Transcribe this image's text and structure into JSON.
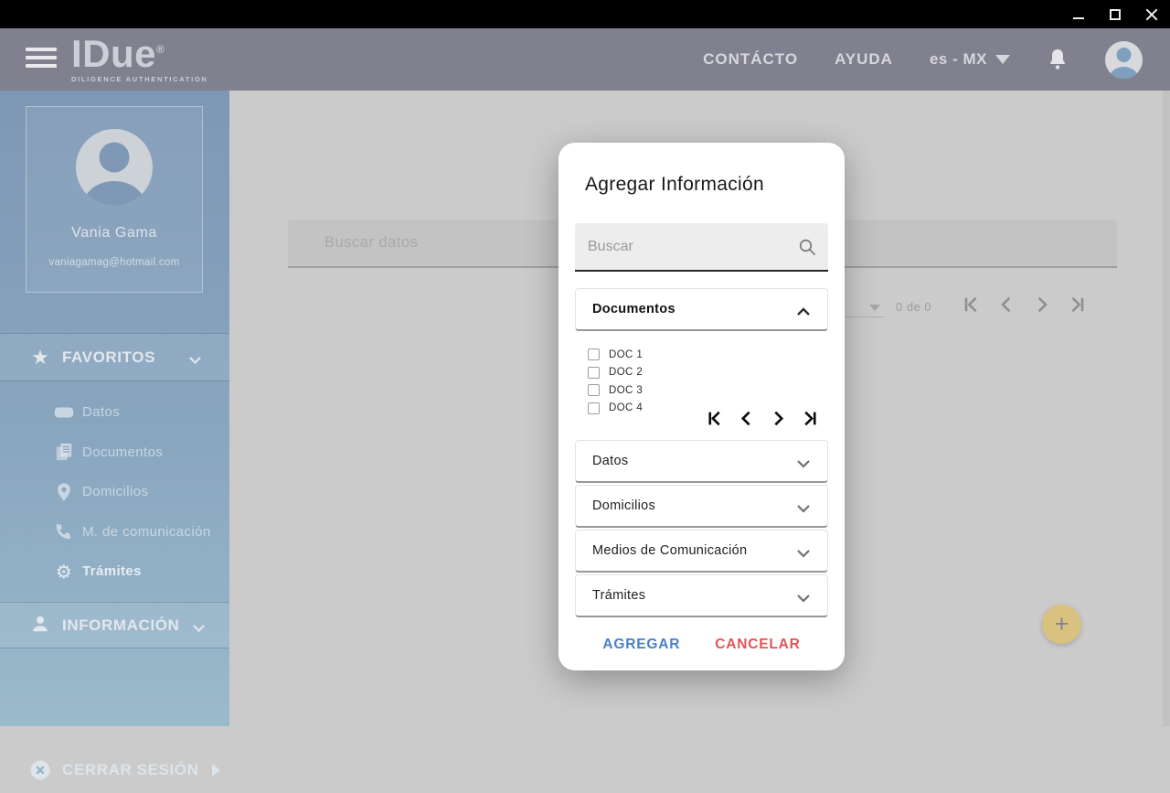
{
  "titlebar": {
    "controls": {
      "minimize": "minimize",
      "maximize": "maximize",
      "close": "close"
    }
  },
  "header": {
    "brand": {
      "name": "IDue",
      "registered_mark": "®",
      "tagline": "DILIGENCE AUTHENTICATION"
    },
    "nav": {
      "contact": "CONTÁCTO",
      "help": "AYUDA"
    },
    "language": "es - MX"
  },
  "sidebar": {
    "profile": {
      "name": "Vania Gama",
      "email": "vaniagamag@hotmail.com"
    },
    "favorites": {
      "label": "FAVORITOS",
      "items": [
        {
          "label": "Datos",
          "icon": "card-icon"
        },
        {
          "label": "Documentos",
          "icon": "documents-icon"
        },
        {
          "label": "Domicilios",
          "icon": "location-pin-icon"
        },
        {
          "label": "M. de comunicación",
          "icon": "phone-icon"
        },
        {
          "label": "Trámites",
          "icon": "gear-icon",
          "active": true
        }
      ]
    },
    "information_label": "INFORMACIÓN",
    "logout_label": "CERRAR SESIÓN"
  },
  "main": {
    "search_placeholder": "Buscar datos",
    "pagination": {
      "range_label": "0 de 0"
    },
    "fab_label": "+"
  },
  "modal": {
    "title": "Agregar Información",
    "search_placeholder": "Buscar",
    "sections": [
      {
        "label": "Documentos",
        "expanded": true,
        "items": [
          "DOC 1",
          "DOC 2",
          "DOC 3",
          "DOC 4"
        ]
      },
      {
        "label": "Datos",
        "expanded": false
      },
      {
        "label": "Domicilios",
        "expanded": false
      },
      {
        "label": "Medios de Comunicación",
        "expanded": false
      },
      {
        "label": "Trámites",
        "expanded": false
      }
    ],
    "actions": {
      "confirm_label": "AGREGAR",
      "cancel_label": "CANCELAR"
    }
  },
  "colors": {
    "header_bg": "#81808f",
    "sidebar_top": "#7e97b5",
    "sidebar_bottom": "#9bbacb",
    "main_bg": "#cbcbcb",
    "accent_blue": "#4a80c4",
    "accent_red": "#e05555",
    "fab_gold": "#d9c280"
  }
}
